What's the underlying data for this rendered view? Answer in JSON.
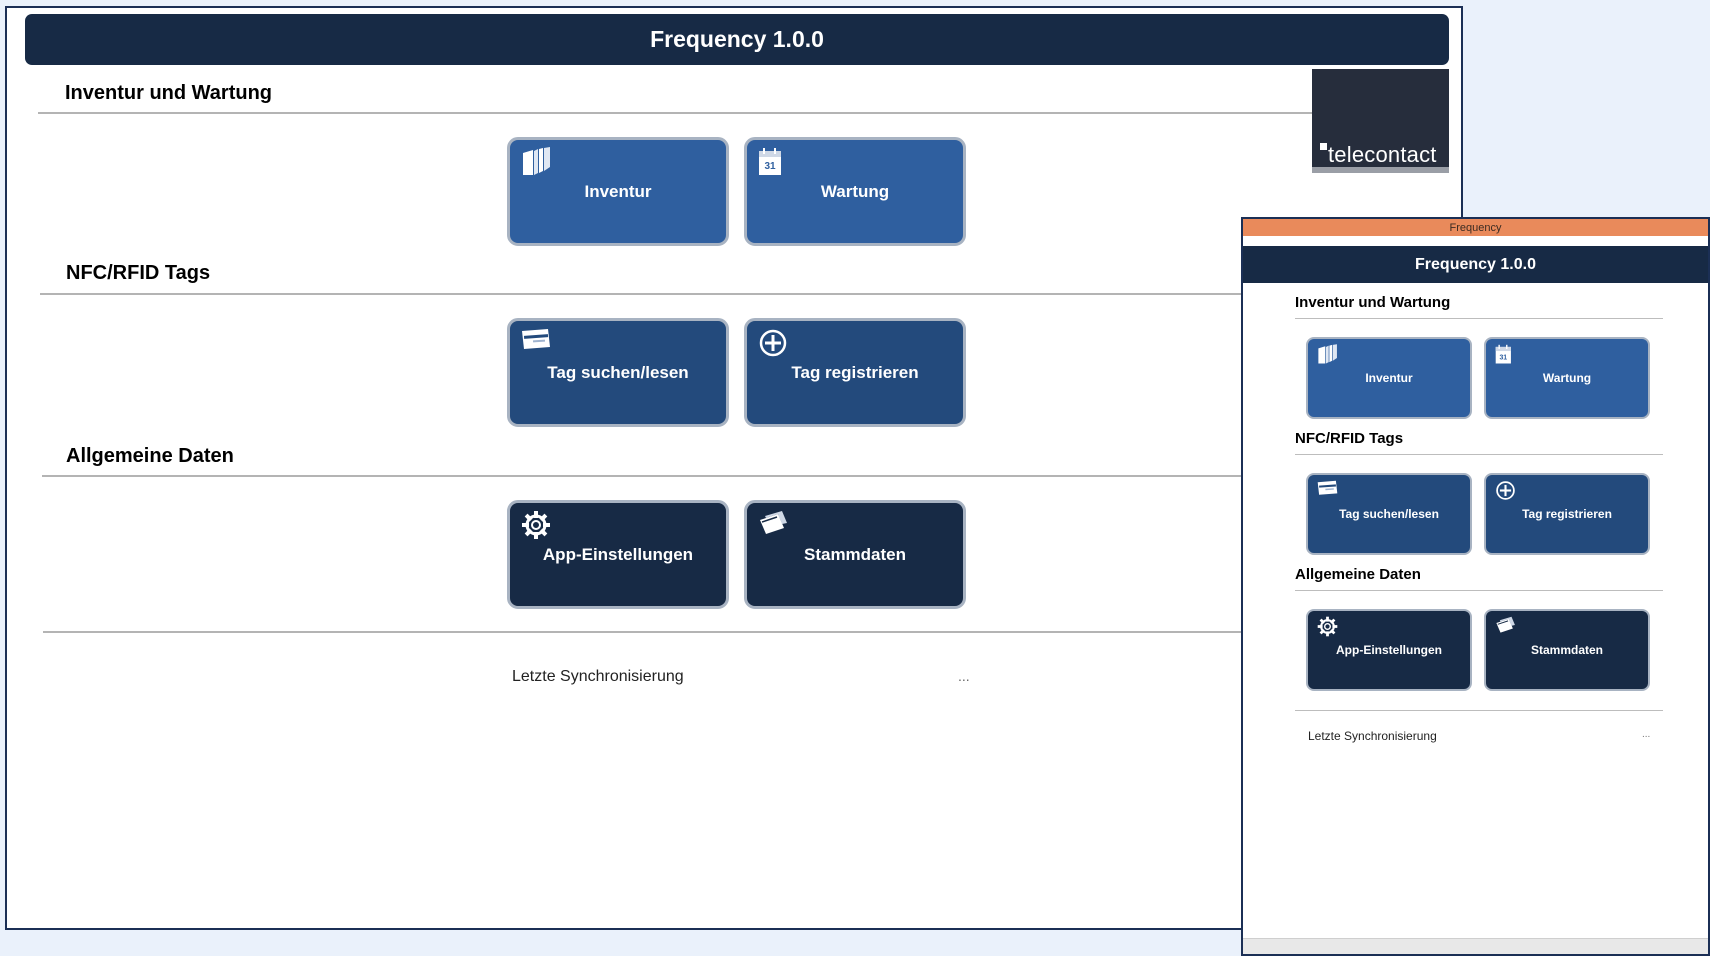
{
  "app": {
    "header_title": "Frequency 1.0.0",
    "window_title": "Frequency",
    "logo_text": "telecontact"
  },
  "sections": {
    "inventory": "Inventur und Wartung",
    "tags": "NFC/RFID Tags",
    "general": "Allgemeine Daten"
  },
  "tiles": {
    "inventur": "Inventur",
    "wartung": "Wartung",
    "tag_search": "Tag suchen/lesen",
    "tag_register": "Tag registrieren",
    "app_settings": "App-Einstellungen",
    "master_data": "Stammdaten"
  },
  "icons": {
    "inventur": "book-icon",
    "wartung": "calendar-icon",
    "tag_search": "card-icon",
    "tag_register": "plus-circle-icon",
    "app_settings": "gear-icon",
    "master_data": "cards-icon",
    "calendar_day": "31"
  },
  "sync": {
    "label": "Letzte Synchronisierung",
    "value": "..."
  },
  "colors": {
    "header": "#172a45",
    "tile_light": "#2f5f9f",
    "tile_mid": "#234a7c",
    "tile_dark": "#172a45",
    "window_titlebar": "#e98a5b"
  }
}
